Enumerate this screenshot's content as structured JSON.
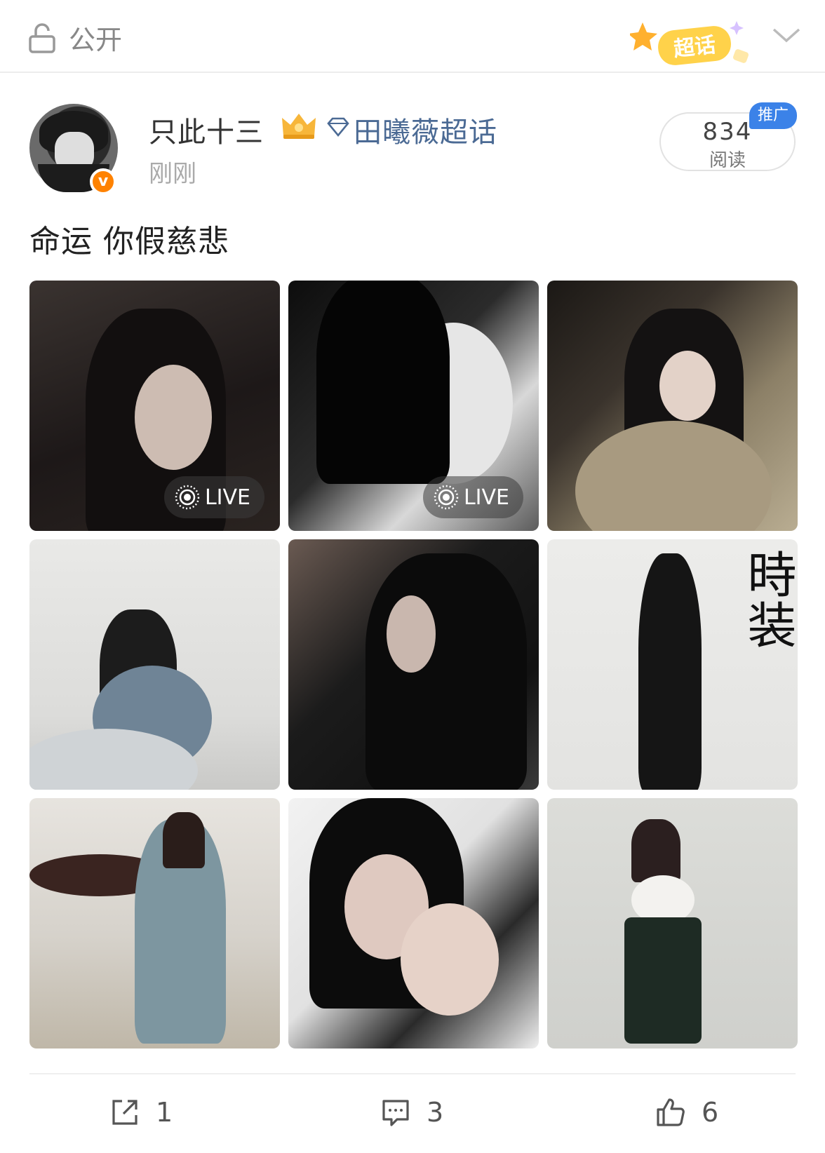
{
  "topbar": {
    "privacy_label": "公开",
    "supertopic_badge_label": "超话"
  },
  "post": {
    "username": "只此十三",
    "topic_link": "田曦薇超话",
    "timestamp": "刚刚",
    "reads": {
      "count": "834",
      "label": "阅读",
      "promo_tag": "推广"
    },
    "text": "命运 你假慈悲",
    "images": [
      {
        "live": true,
        "live_label": "LIVE"
      },
      {
        "live": true,
        "live_label": "LIVE"
      },
      {
        "live": false
      },
      {
        "live": false
      },
      {
        "live": false
      },
      {
        "live": false,
        "overlay_text": "時装"
      },
      {
        "live": false
      },
      {
        "live": false
      },
      {
        "live": false
      }
    ]
  },
  "actions": {
    "repost_count": "1",
    "comment_count": "3",
    "like_count": "6"
  },
  "colors": {
    "accent_blue": "#3b82e8",
    "link_blue": "#4b6a94",
    "verified_orange": "#ff8200"
  }
}
